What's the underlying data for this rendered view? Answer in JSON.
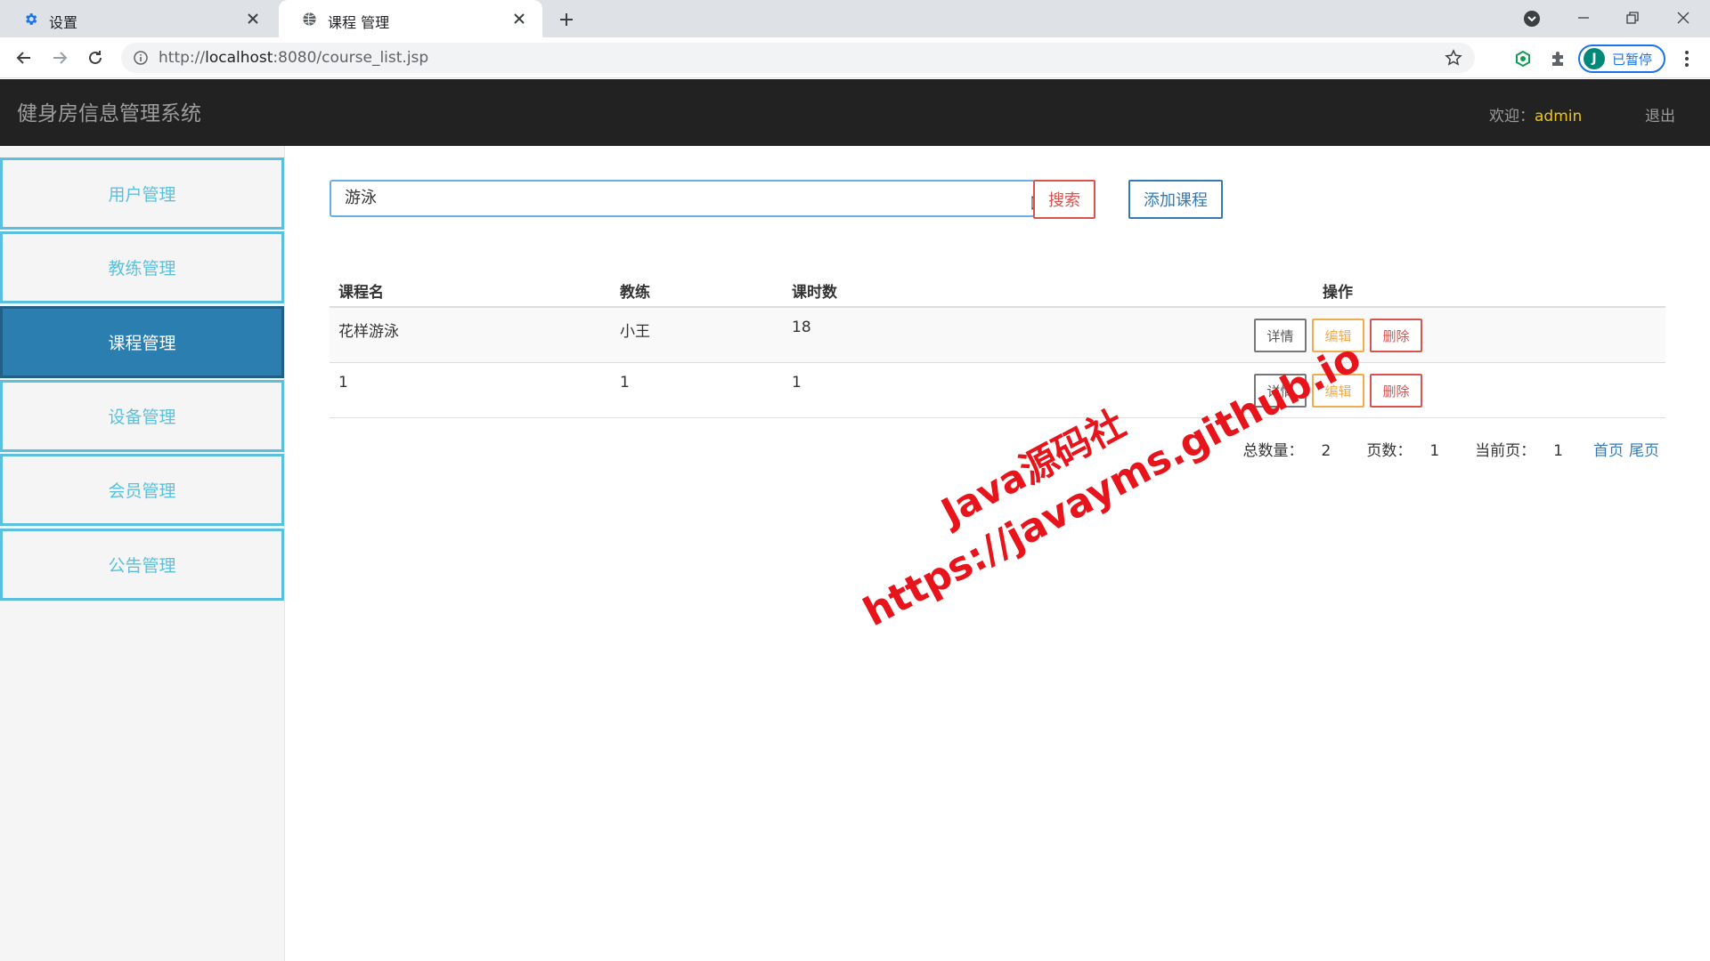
{
  "browser": {
    "tabs": [
      {
        "title": "设置",
        "icon": "gear-icon",
        "active": false
      },
      {
        "title": "课程 管理",
        "icon": "globe-icon",
        "active": true
      }
    ],
    "url_prefix": "http://",
    "url_host": "localhost",
    "url_rest": ":8080/course_list.jsp",
    "profile_initial": "J",
    "profile_status": "已暂停"
  },
  "header": {
    "brand": "健身房信息管理系统",
    "welcome_label": "欢迎：",
    "username": "admin",
    "logout": "退出"
  },
  "sidebar": {
    "items": [
      {
        "label": "用户管理",
        "active": false
      },
      {
        "label": "教练管理",
        "active": false
      },
      {
        "label": "课程管理",
        "active": true
      },
      {
        "label": "设备管理",
        "active": false
      },
      {
        "label": "会员管理",
        "active": false
      },
      {
        "label": "公告管理",
        "active": false
      }
    ]
  },
  "search": {
    "value": "游泳",
    "button": "搜索",
    "add_button": "添加课程"
  },
  "table": {
    "headers": [
      "课程名",
      "教练",
      "课时数",
      "操作"
    ],
    "rows": [
      {
        "name": "花样游泳",
        "coach": "小王",
        "hours": "18"
      },
      {
        "name": "1",
        "coach": "1",
        "hours": "1"
      }
    ],
    "actions": {
      "detail": "详情",
      "edit": "编辑",
      "delete": "删除"
    }
  },
  "pagination": {
    "total_label": "总数量：",
    "total": "2",
    "pages_label": "页数：",
    "pages": "1",
    "current_label": "当前页：",
    "current": "1",
    "first": "首页",
    "last": "尾页"
  },
  "watermark": {
    "line1": "Java源码社",
    "line2": "https://javayms.github.io"
  },
  "colors": {
    "header_bg": "#222222",
    "sidebar_accent": "#5bc0de",
    "sidebar_active": "#2a7fb0",
    "danger": "#d9534f",
    "warning": "#f0ad4e",
    "primary": "#337ab7",
    "username": "#f0c419",
    "watermark": "#e8141c"
  }
}
